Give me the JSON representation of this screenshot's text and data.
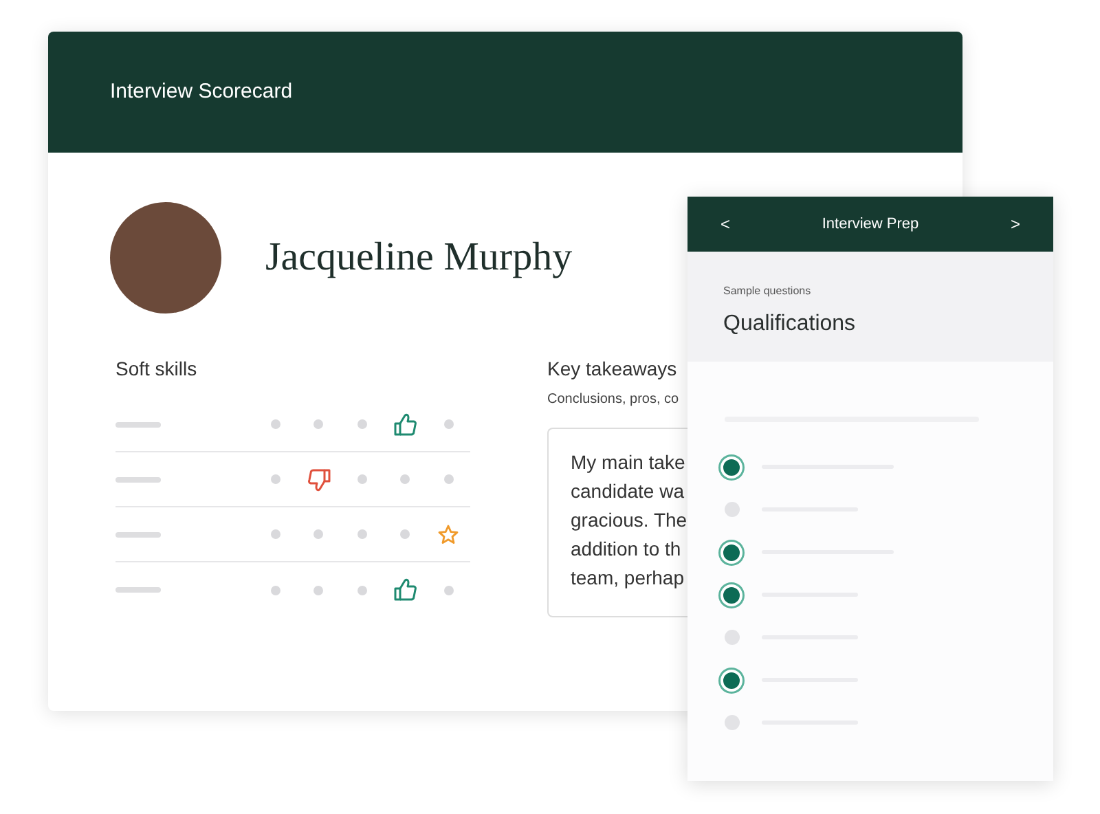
{
  "scorecard": {
    "title": "Interview Scorecard",
    "candidate_name": "Jacqueline Murphy",
    "soft_skills": {
      "heading": "Soft skills",
      "rows": [
        {
          "marks": [
            {
              "kind": "dot"
            },
            {
              "kind": "dot"
            },
            {
              "kind": "dot"
            },
            {
              "kind": "thumbs_up"
            },
            {
              "kind": "dot"
            }
          ]
        },
        {
          "marks": [
            {
              "kind": "dot"
            },
            {
              "kind": "thumbs_down"
            },
            {
              "kind": "dot"
            },
            {
              "kind": "dot"
            },
            {
              "kind": "dot"
            }
          ]
        },
        {
          "marks": [
            {
              "kind": "dot"
            },
            {
              "kind": "dot"
            },
            {
              "kind": "dot"
            },
            {
              "kind": "dot"
            },
            {
              "kind": "star"
            }
          ]
        },
        {
          "marks": [
            {
              "kind": "dot"
            },
            {
              "kind": "dot"
            },
            {
              "kind": "dot"
            },
            {
              "kind": "thumbs_up"
            },
            {
              "kind": "dot"
            }
          ]
        }
      ]
    },
    "key_takeaways": {
      "heading": "Key takeaways",
      "hint": "Conclusions, pros, co",
      "text_lines": [
        "My main take",
        "candidate wa",
        "gracious. The",
        "addition to th",
        "team, perhap"
      ]
    }
  },
  "prep": {
    "prev": "<",
    "title": "Interview Prep",
    "next": ">",
    "eyebrow": "Sample questions",
    "heading": "Qualifications",
    "questions": [
      {
        "checked": true
      },
      {
        "checked": false
      },
      {
        "checked": true
      },
      {
        "checked": true
      },
      {
        "checked": false
      },
      {
        "checked": true
      },
      {
        "checked": false
      }
    ]
  }
}
